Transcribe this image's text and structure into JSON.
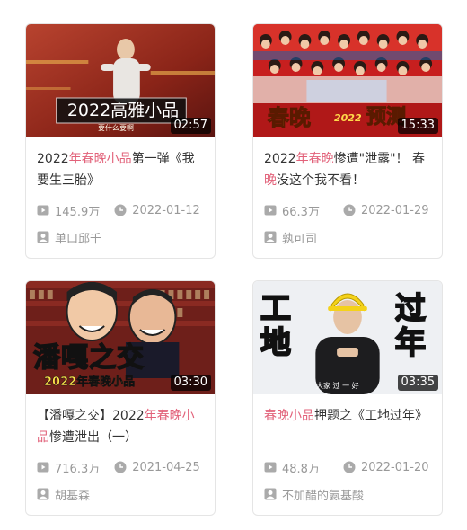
{
  "colors": {
    "highlight": "#e2627a",
    "meta_text": "#999999",
    "title_text": "#333333",
    "duration_bg": "#000000"
  },
  "cards": [
    {
      "thumbnail_caption": "2022高雅小品",
      "thumbnail_subtitle": "要什么要啊",
      "duration": "02:57",
      "title_parts": [
        {
          "text": "2022",
          "hl": false
        },
        {
          "text": "年春晚小品",
          "hl": true
        },
        {
          "text": "第一弹《我要生三胎》",
          "hl": false
        }
      ],
      "plays": "145.9万",
      "date": "2022-01-12",
      "author": "单口邱千",
      "play_icon": "play-icon",
      "date_icon": "clock-icon",
      "author_icon": "user-icon"
    },
    {
      "thumbnail_caption": "春晚",
      "thumbnail_caption_2": "预测",
      "thumbnail_badge": "2022",
      "duration": "15:33",
      "title_parts": [
        {
          "text": "2022",
          "hl": false
        },
        {
          "text": "年春晚",
          "hl": true
        },
        {
          "text": "惨遭\"泄露\"！ 春",
          "hl": false
        },
        {
          "text": "晚",
          "hl": true
        },
        {
          "text": "没这个我不看！",
          "hl": false
        }
      ],
      "plays": "66.3万",
      "date": "2022-01-29",
      "author": "孰可司",
      "play_icon": "play-icon",
      "date_icon": "clock-icon",
      "author_icon": "user-icon"
    },
    {
      "thumbnail_caption": "潘嘎之交",
      "thumbnail_subtitle": "2022年春晚小品",
      "duration": "03:30",
      "title_parts": [
        {
          "text": "【潘嘎之交】2022",
          "hl": false
        },
        {
          "text": "年春晚小品",
          "hl": true
        },
        {
          "text": "惨遭泄出（一）",
          "hl": false
        }
      ],
      "plays": "716.3万",
      "date": "2021-04-25",
      "author": "胡基森",
      "play_icon": "play-icon",
      "date_icon": "clock-icon",
      "author_icon": "user-icon"
    },
    {
      "thumbnail_caption_left": "工地",
      "thumbnail_caption_right": "过年",
      "thumbnail_subtitle": "大家 过 一 好",
      "duration": "03:35",
      "title_parts": [
        {
          "text": "春晚小品",
          "hl": true
        },
        {
          "text": "押题之《工地过年》",
          "hl": false
        }
      ],
      "plays": "48.8万",
      "date": "2022-01-20",
      "author": "不加醋的氨基酸",
      "play_icon": "play-icon",
      "date_icon": "clock-icon",
      "author_icon": "user-icon"
    }
  ]
}
